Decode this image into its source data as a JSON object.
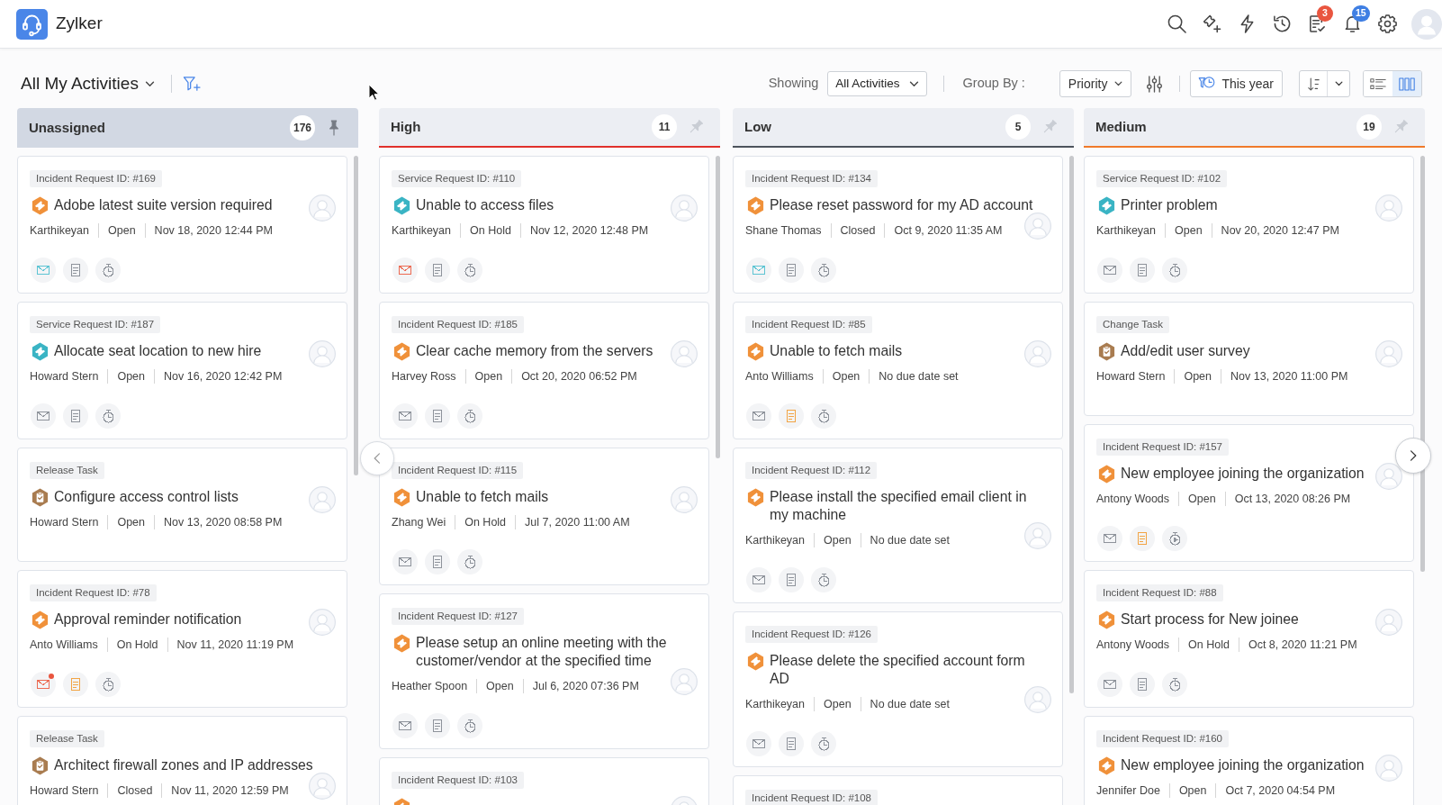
{
  "header": {
    "app_name": "Zylker",
    "icons": [
      {
        "kind": "search"
      },
      {
        "kind": "ticket_add"
      },
      {
        "kind": "bolt"
      },
      {
        "kind": "history"
      },
      {
        "kind": "tasks",
        "badge": "3",
        "color": "#e9553f"
      },
      {
        "kind": "bell",
        "badge": "15",
        "color": "#3f7fe3"
      },
      {
        "kind": "settings"
      }
    ]
  },
  "toolbar": {
    "view_title": "All My Activities",
    "showing_label": "Showing",
    "showing_value": "All Activities",
    "group_by_label": "Group By :",
    "group_by_value": "Priority",
    "period": "This year",
    "views": [
      {
        "kind": "list",
        "selected": false
      },
      {
        "kind": "board",
        "selected": true
      }
    ]
  },
  "columns": [
    {
      "title": "Unassigned",
      "count": "176",
      "pinned": true,
      "cards": [
        {
          "kind": "incident",
          "tag": "Incident Request ID: #169",
          "title": "Adobe latest suite version required",
          "details": [
            "Karthikeyan",
            "Open",
            "Nov 18, 2020 12:44 PM"
          ],
          "actions": [
            {
              "kind": "mail",
              "color": "#5dc4d3",
              "dot": false
            },
            {
              "kind": "notes",
              "color": "#8e939b",
              "dot": false
            },
            {
              "kind": "timer",
              "color": "#8e939b",
              "dot": false
            }
          ]
        },
        {
          "kind": "service",
          "tag": "Service Request ID: #187",
          "title": "Allocate seat location to new hire",
          "details": [
            "Howard Stern",
            "Open",
            "Nov 16, 2020 12:42 PM"
          ],
          "actions": [
            {
              "kind": "mail",
              "color": "#8e939b",
              "dot": false
            },
            {
              "kind": "notes",
              "color": "#8e939b",
              "dot": false
            },
            {
              "kind": "timer",
              "color": "#8e939b",
              "dot": false
            }
          ]
        },
        {
          "kind": "task",
          "tag": "Release Task",
          "title": "Configure access control lists",
          "details": [
            "Howard Stern",
            "Open",
            "Nov 13, 2020 08:58 PM"
          ]
        },
        {
          "kind": "incident",
          "tag": "Incident Request ID: #78",
          "title": "Approval reminder notification",
          "details": [
            "Anto Williams",
            "On Hold",
            "Nov 11, 2020 11:19 PM"
          ],
          "actions": [
            {
              "kind": "mail",
              "color": "#ec6a52",
              "dot": true
            },
            {
              "kind": "notes",
              "color": "#f2a444",
              "dot": false
            },
            {
              "kind": "timer",
              "color": "#8e939b",
              "dot": false
            }
          ]
        },
        {
          "kind": "task",
          "tag": "Release Task",
          "title": "Architect firewall zones and IP addresses",
          "details": [
            "Howard Stern",
            "Closed",
            "Nov 11, 2020 12:59 PM"
          ]
        }
      ]
    },
    {
      "title": "High",
      "count": "11",
      "pinned": false,
      "color": "#e0302b",
      "cards": [
        {
          "kind": "service",
          "tag": "Service Request ID: #110",
          "title": "Unable to access files",
          "details": [
            "Karthikeyan",
            "On Hold",
            "Nov 12, 2020 12:48 PM"
          ],
          "actions": [
            {
              "kind": "mail",
              "color": "#ec6a52",
              "dot": false
            },
            {
              "kind": "notes",
              "color": "#8e939b",
              "dot": false
            },
            {
              "kind": "timer",
              "color": "#8e939b",
              "dot": false
            }
          ]
        },
        {
          "kind": "incident",
          "tag": "Incident Request ID: #185",
          "title": "Clear cache memory from the servers",
          "details": [
            "Harvey Ross",
            "Open",
            "Oct 20, 2020 06:52 PM"
          ],
          "actions": [
            {
              "kind": "mail",
              "color": "#8e939b",
              "dot": false
            },
            {
              "kind": "notes",
              "color": "#8e939b",
              "dot": false
            },
            {
              "kind": "timer",
              "color": "#8e939b",
              "dot": false
            }
          ]
        },
        {
          "kind": "incident",
          "tag": "Incident Request ID: #115",
          "title": "Unable to fetch mails",
          "details": [
            "Zhang Wei",
            "On Hold",
            "Jul 7, 2020 11:00 AM"
          ],
          "actions": [
            {
              "kind": "mail",
              "color": "#8e939b",
              "dot": false
            },
            {
              "kind": "notes",
              "color": "#8e939b",
              "dot": false
            },
            {
              "kind": "timer",
              "color": "#8e939b",
              "dot": false
            }
          ]
        },
        {
          "kind": "incident",
          "tag": "Incident Request ID: #127",
          "title": "Please setup an online meeting with the customer/vendor at the specified time",
          "details": [
            "Heather Spoon",
            "Open",
            "Jul 6, 2020 07:36 PM"
          ],
          "actions": [
            {
              "kind": "mail",
              "color": "#8e939b",
              "dot": false
            },
            {
              "kind": "notes",
              "color": "#8e939b",
              "dot": false
            },
            {
              "kind": "timer",
              "color": "#8e939b",
              "dot": false
            }
          ]
        },
        {
          "kind": "incident",
          "tag": "Incident Request ID: #103"
        }
      ]
    },
    {
      "title": "Low",
      "count": "5",
      "pinned": false,
      "color": "#4d535c",
      "cards": [
        {
          "kind": "incident",
          "tag": "Incident Request ID: #134",
          "title": "Please reset password for my AD account",
          "details": [
            "Shane Thomas",
            "Closed",
            "Oct 9, 2020 11:35 AM"
          ],
          "actions": [
            {
              "kind": "mail",
              "color": "#5dc4d3",
              "dot": false
            },
            {
              "kind": "notes",
              "color": "#8e939b",
              "dot": false
            },
            {
              "kind": "timer",
              "color": "#8e939b",
              "dot": false
            }
          ]
        },
        {
          "kind": "incident",
          "tag": "Incident Request ID: #85",
          "title": "Unable to fetch mails",
          "details": [
            "Anto Williams",
            "Open",
            "No due date set"
          ],
          "actions": [
            {
              "kind": "mail",
              "color": "#8e939b",
              "dot": false
            },
            {
              "kind": "notes",
              "color": "#f2a444",
              "dot": false
            },
            {
              "kind": "timer",
              "color": "#8e939b",
              "dot": false
            }
          ]
        },
        {
          "kind": "incident",
          "tag": "Incident Request ID: #112",
          "title": "Please install the specified email client in my machine",
          "details": [
            "Karthikeyan",
            "Open",
            "No due date set"
          ],
          "actions": [
            {
              "kind": "mail",
              "color": "#8e939b",
              "dot": false
            },
            {
              "kind": "notes",
              "color": "#8e939b",
              "dot": false
            },
            {
              "kind": "timer",
              "color": "#8e939b",
              "dot": false
            }
          ]
        },
        {
          "kind": "incident",
          "tag": "Incident Request ID: #126",
          "title": "Please delete the specified account form AD",
          "details": [
            "Karthikeyan",
            "Open",
            "No due date set"
          ],
          "actions": [
            {
              "kind": "mail",
              "color": "#8e939b",
              "dot": false
            },
            {
              "kind": "notes",
              "color": "#8e939b",
              "dot": false
            },
            {
              "kind": "timer",
              "color": "#8e939b",
              "dot": false
            }
          ]
        },
        {
          "kind": "incident",
          "tag": "Incident Request ID: #108"
        }
      ]
    },
    {
      "title": "Medium",
      "count": "19",
      "pinned": false,
      "color": "#f07a2a",
      "cards": [
        {
          "kind": "service",
          "tag": "Service Request ID: #102",
          "title": "Printer problem",
          "details": [
            "Karthikeyan",
            "Open",
            "Nov 20, 2020 12:47 PM"
          ],
          "actions": [
            {
              "kind": "mail",
              "color": "#8e939b",
              "dot": false
            },
            {
              "kind": "notes",
              "color": "#8e939b",
              "dot": false
            },
            {
              "kind": "timer",
              "color": "#8e939b",
              "dot": false
            }
          ]
        },
        {
          "kind": "task",
          "tag": "Change Task",
          "title": "Add/edit user survey",
          "details": [
            "Howard Stern",
            "Open",
            "Nov 13, 2020 11:00 PM"
          ]
        },
        {
          "kind": "incident",
          "tag": "Incident Request ID: #157",
          "title": "New employee joining the organization",
          "details": [
            "Antony Woods",
            "Open",
            "Oct 13, 2020 08:26 PM"
          ],
          "actions": [
            {
              "kind": "mail",
              "color": "#8e939b",
              "dot": false
            },
            {
              "kind": "notes",
              "color": "#f2a444",
              "dot": false
            },
            {
              "kind": "timer_play",
              "color": "#8e939b",
              "dot": false
            }
          ]
        },
        {
          "kind": "incident",
          "tag": "Incident Request ID: #88",
          "title": "Start process for New joinee",
          "details": [
            "Antony Woods",
            "On Hold",
            "Oct 8, 2020 11:21 PM"
          ],
          "actions": [
            {
              "kind": "mail",
              "color": "#8e939b",
              "dot": false
            },
            {
              "kind": "notes",
              "color": "#8e939b",
              "dot": false
            },
            {
              "kind": "timer",
              "color": "#8e939b",
              "dot": false
            }
          ]
        },
        {
          "kind": "incident",
          "tag": "Incident Request ID: #160",
          "title": "New employee joining the organization",
          "details": [
            "Jennifer Doe",
            "Open",
            "Oct 7, 2020 04:54 PM"
          ]
        }
      ]
    }
  ]
}
